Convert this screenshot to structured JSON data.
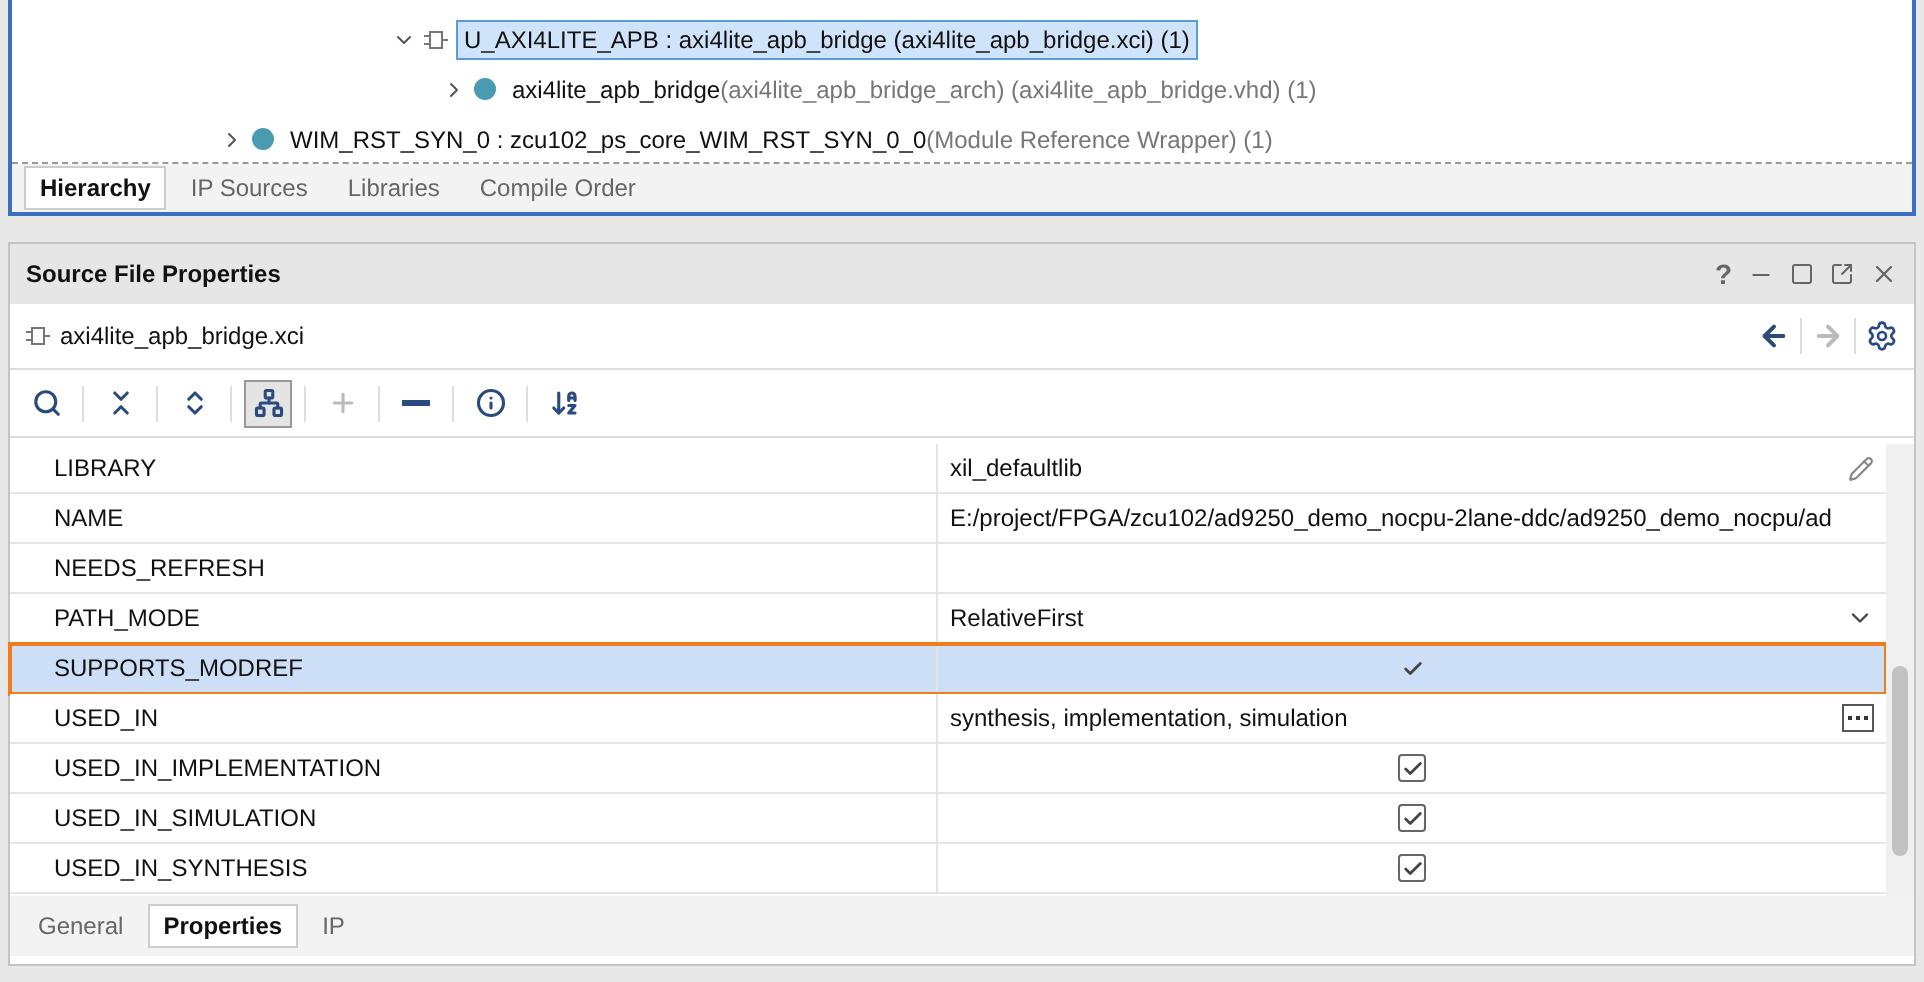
{
  "hierarchy": {
    "tree": [
      {
        "label": "U_AXI4LITE_APB : axi4lite_apb_bridge (axi4lite_apb_bridge.xci) (1)",
        "kind": "ip",
        "selected": true,
        "expanded": true,
        "children": [
          {
            "label": "axi4lite_apb_bridge",
            "detail": "(axi4lite_apb_bridge_arch) (axi4lite_apb_bridge.vhd) (1)",
            "kind": "module",
            "selected": false,
            "expanded": false
          }
        ]
      },
      {
        "label": "WIM_RST_SYN_0 : zcu102_ps_core_WIM_RST_SYN_0_0",
        "detail": "(Module Reference Wrapper) (1)",
        "kind": "module",
        "selected": false,
        "expanded": false
      }
    ],
    "tabs": [
      {
        "label": "Hierarchy",
        "selected": true
      },
      {
        "label": "IP Sources",
        "selected": false
      },
      {
        "label": "Libraries",
        "selected": false
      },
      {
        "label": "Compile Order",
        "selected": false
      }
    ]
  },
  "properties": {
    "title": "Source File Properties",
    "help": "?",
    "file": "axi4lite_apb_bridge.xci",
    "back_disabled": false,
    "forward_disabled": true,
    "toolbar": [
      {
        "kind": "search",
        "pressed": false,
        "disabled": false
      },
      {
        "kind": "collapse",
        "pressed": false,
        "disabled": false
      },
      {
        "kind": "expand",
        "pressed": false,
        "disabled": false
      },
      {
        "kind": "hierarchy",
        "pressed": true,
        "disabled": false
      },
      {
        "kind": "add",
        "pressed": false,
        "disabled": true
      },
      {
        "kind": "remove",
        "pressed": false,
        "disabled": false
      },
      {
        "kind": "info",
        "pressed": false,
        "disabled": false
      },
      {
        "kind": "sort",
        "pressed": false,
        "disabled": false
      }
    ],
    "rows": [
      {
        "name": "LIBRARY",
        "kind": "editable",
        "value": "xil_defaultlib",
        "selected": false,
        "outlined": false
      },
      {
        "name": "NAME",
        "kind": "text",
        "value": "E:/project/FPGA/zcu102/ad9250_demo_nocpu-2lane-ddc/ad9250_demo_nocpu/ad",
        "selected": false,
        "outlined": false
      },
      {
        "name": "NEEDS_REFRESH",
        "kind": "text",
        "selected": false,
        "outlined": false
      },
      {
        "name": "PATH_MODE",
        "kind": "dropdown",
        "value": "RelativeFirst",
        "selected": false,
        "outlined": false
      },
      {
        "name": "SUPPORTS_MODREF",
        "kind": "tick",
        "checked": true,
        "selected": true,
        "outlined": true
      },
      {
        "name": "USED_IN",
        "kind": "list",
        "value": "synthesis, implementation, simulation",
        "selected": false,
        "outlined": false
      },
      {
        "name": "USED_IN_IMPLEMENTATION",
        "kind": "checkbox",
        "checked": true,
        "selected": false,
        "outlined": false
      },
      {
        "name": "USED_IN_SIMULATION",
        "kind": "checkbox",
        "checked": true,
        "selected": false,
        "outlined": false
      },
      {
        "name": "USED_IN_SYNTHESIS",
        "kind": "checkbox",
        "checked": true,
        "selected": false,
        "outlined": false
      }
    ],
    "tabs": [
      {
        "label": "General",
        "selected": false
      },
      {
        "label": "Properties",
        "selected": true
      },
      {
        "label": "IP",
        "selected": false
      }
    ]
  }
}
